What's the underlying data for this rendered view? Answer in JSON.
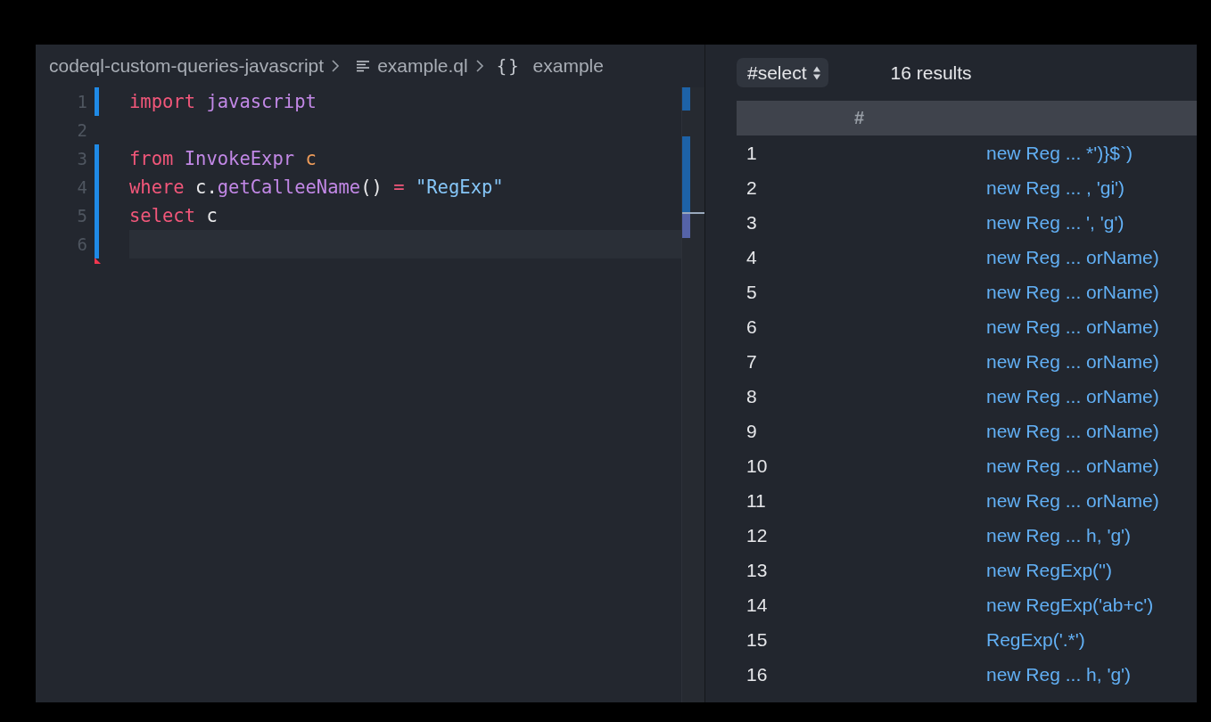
{
  "breadcrumb": [
    {
      "kind": "folder",
      "label": "codeql-custom-queries-javascript"
    },
    {
      "kind": "file",
      "label": "example.ql"
    },
    {
      "kind": "symbol",
      "icon_text": "{}",
      "label": "example"
    }
  ],
  "code_lines": [
    {
      "number": "1",
      "modified": true,
      "current": false,
      "tokens": [
        {
          "kind": "keyword",
          "text": "import"
        },
        {
          "kind": "type",
          "text": " javascript"
        }
      ]
    },
    {
      "number": "2",
      "modified": false,
      "current": false
    },
    {
      "number": "3",
      "modified": true,
      "current": false,
      "tokens": [
        {
          "kind": "keyword",
          "text": "from"
        },
        {
          "kind": "type",
          "text": " InvokeExpr"
        },
        {
          "kind": "variable",
          "text": " c"
        }
      ]
    },
    {
      "number": "4",
      "modified": true,
      "current": false,
      "tokens": [
        {
          "kind": "keyword",
          "text": "where"
        },
        {
          "kind": "plain",
          "text": " c."
        },
        {
          "kind": "function",
          "text": "getCalleeName"
        },
        {
          "kind": "plain",
          "text": "() "
        },
        {
          "kind": "keyword",
          "text": "="
        },
        {
          "kind": "string",
          "text": " \"RegExp\""
        }
      ]
    },
    {
      "number": "5",
      "modified": true,
      "current": false,
      "tokens": [
        {
          "kind": "keyword",
          "text": "select"
        },
        {
          "kind": "plain",
          "text": " c"
        }
      ]
    },
    {
      "number": "6",
      "modified": true,
      "current": true
    }
  ],
  "results": {
    "result_set": "#select",
    "count": "16 results",
    "columns": [
      "#"
    ],
    "rows": [
      {
        "index": "1",
        "value": "new Reg ... *')}$`)"
      },
      {
        "index": "2",
        "value": "new Reg ... , 'gi')"
      },
      {
        "index": "3",
        "value": "new Reg ... ', 'g')"
      },
      {
        "index": "4",
        "value": "new Reg ... orName)"
      },
      {
        "index": "5",
        "value": "new Reg ... orName)"
      },
      {
        "index": "6",
        "value": "new Reg ... orName)"
      },
      {
        "index": "7",
        "value": "new Reg ... orName)"
      },
      {
        "index": "8",
        "value": "new Reg ... orName)"
      },
      {
        "index": "9",
        "value": "new Reg ... orName)"
      },
      {
        "index": "10",
        "value": "new Reg ... orName)"
      },
      {
        "index": "11",
        "value": "new Reg ... orName)"
      },
      {
        "index": "12",
        "value": "new Reg ... h, 'g')"
      },
      {
        "index": "13",
        "value": "new RegExp('')"
      },
      {
        "index": "14",
        "value": "new RegExp('ab+c')"
      },
      {
        "index": "15",
        "value": "RegExp('.*')"
      },
      {
        "index": "16",
        "value": "new Reg ... h, 'g')"
      }
    ]
  }
}
